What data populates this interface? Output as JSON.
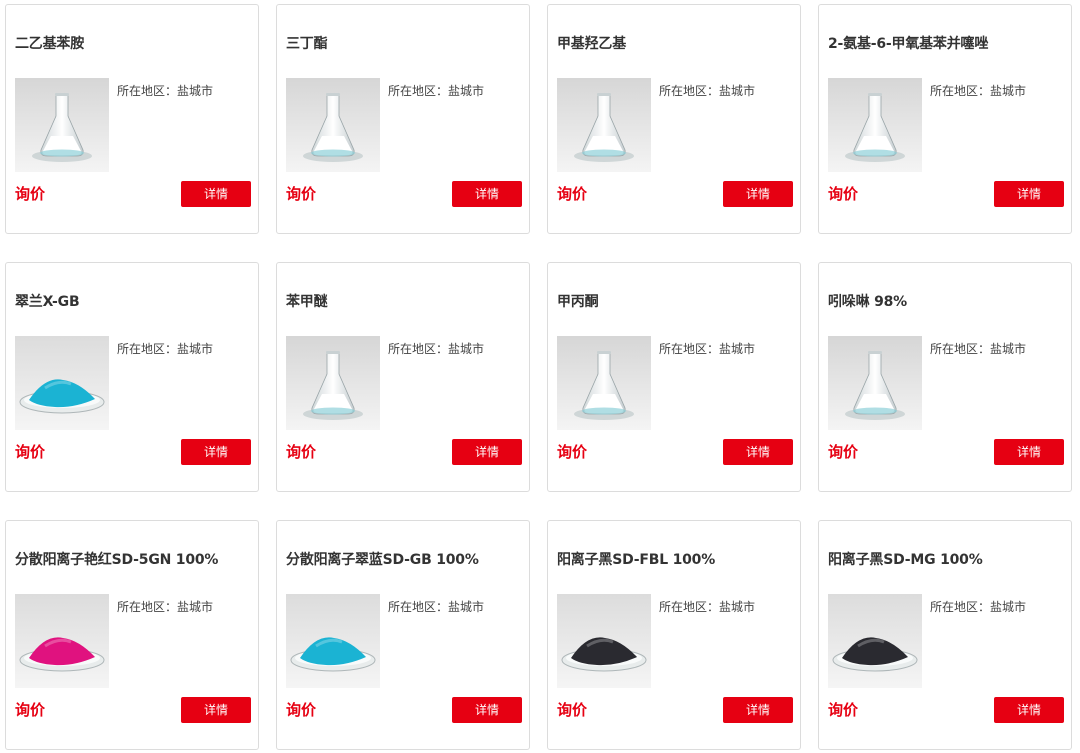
{
  "location_label": "所在地区：",
  "price_label": "询价",
  "detail_label": "详情",
  "products": [
    {
      "name": "二乙基苯胺",
      "city": "盐城市",
      "image": "flask",
      "powder_color": "#ffffff"
    },
    {
      "name": "三丁酯",
      "city": "盐城市",
      "image": "flask",
      "powder_color": "#ffffff"
    },
    {
      "name": "甲基羟乙基",
      "city": "盐城市",
      "image": "flask",
      "powder_color": "#ffffff"
    },
    {
      "name": "2-氨基-6-甲氧基苯并噻唑",
      "city": "盐城市",
      "image": "flask",
      "powder_color": "#ffffff"
    },
    {
      "name": "翠兰X-GB",
      "city": "盐城市",
      "image": "powder",
      "powder_color": "#1bb3d3"
    },
    {
      "name": "苯甲醚",
      "city": "盐城市",
      "image": "flask",
      "powder_color": "#ffffff"
    },
    {
      "name": "甲丙酮",
      "city": "盐城市",
      "image": "flask",
      "powder_color": "#ffffff"
    },
    {
      "name": "吲哚啉 98%",
      "city": "盐城市",
      "image": "flask",
      "powder_color": "#ffffff"
    },
    {
      "name": "分散阳离子艳红SD-5GN 100%",
      "city": "盐城市",
      "image": "powder",
      "powder_color": "#e0127f"
    },
    {
      "name": "分散阳离子翠蓝SD-GB 100%",
      "city": "盐城市",
      "image": "powder",
      "powder_color": "#1bb3d3"
    },
    {
      "name": "阳离子黑SD-FBL 100%",
      "city": "盐城市",
      "image": "powder",
      "powder_color": "#2a2a30"
    },
    {
      "name": "阳离子黑SD-MG 100%",
      "city": "盐城市",
      "image": "powder",
      "powder_color": "#2a2a30"
    }
  ]
}
